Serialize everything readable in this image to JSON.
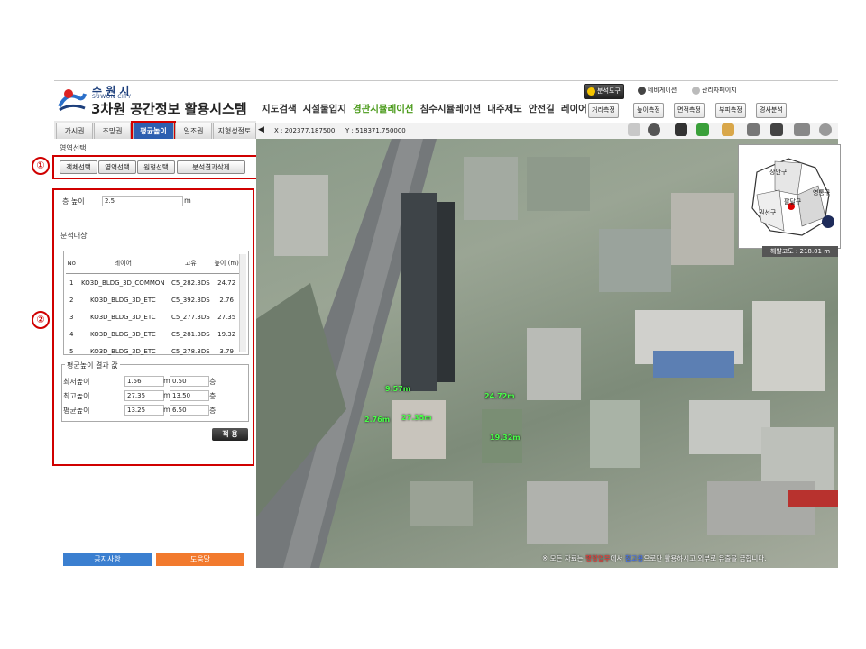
{
  "header": {
    "logo_city": "수 원 시",
    "logo_city_en": "SUWON CITY",
    "title": "3차원 공간정보 활용시스템",
    "nav": [
      "지도검색",
      "시설물입지",
      "경관시뮬레이션",
      "침수시뮬레이션",
      "내주제도",
      "안전길",
      "레이어"
    ],
    "nav_active_index": 2,
    "tools_row1": [
      "분석도구",
      "네비게이션",
      "관리자페이지"
    ],
    "tools_row2": [
      "거리측정",
      "높이측정",
      "면적측정",
      "부피측정",
      "경사분석"
    ]
  },
  "tabs": [
    "가시권",
    "조망권",
    "평균높이",
    "일조권",
    "지형성절토"
  ],
  "active_tab_index": 2,
  "coords": {
    "x": "X : 202377.187500",
    "y": "Y : 518371.750000"
  },
  "panel": {
    "area_select_label": "영역선택",
    "area_buttons": [
      "객체선택",
      "영역선택",
      "원형선택",
      "분석결과삭제"
    ],
    "marker1": "①",
    "marker2": "②",
    "height_label": "층 높이",
    "height_value": "2.5",
    "height_unit": "m",
    "target_label": "분석대상",
    "table": {
      "headers": [
        "No",
        "레이어",
        "고유",
        "높이 (m)"
      ],
      "rows": [
        [
          "1",
          "KO3D_BLDG_3D_COMMON",
          "C5_282.3DS",
          "24.72"
        ],
        [
          "2",
          "KO3D_BLDG_3D_ETC",
          "C5_392.3DS",
          "2.76"
        ],
        [
          "3",
          "KO3D_BLDG_3D_ETC",
          "C5_277.3DS",
          "27.35"
        ],
        [
          "4",
          "KO3D_BLDG_3D_ETC",
          "C5_281.3DS",
          "19.32"
        ],
        [
          "5",
          "KO3D_BLDG_3D_ETC",
          "C5_278.3DS",
          "3.79"
        ]
      ]
    },
    "result_title": "평균높이 결과 값",
    "results": [
      {
        "label": "최저높이",
        "m": "1.56",
        "floors": "0.50",
        "munit": "m",
        "funit": "층"
      },
      {
        "label": "최고높이",
        "m": "27.35",
        "floors": "13.50",
        "munit": "m",
        "funit": "층"
      },
      {
        "label": "평균높이",
        "m": "13.25",
        "floors": "6.50",
        "munit": "m",
        "funit": "층"
      }
    ],
    "apply_label": "적 용"
  },
  "bottom": {
    "notice_btn": "공지사항",
    "help_btn": "도움말"
  },
  "map": {
    "labels": [
      "9.57m",
      "24.72m",
      "2.76m",
      "27.35m",
      "19.32m"
    ],
    "altitude": "해발고도 : 218.01 m",
    "minimap_districts": [
      "장안구",
      "팔달구",
      "영통구",
      "권선구"
    ],
    "notice_prefix": "※ 모든 자료는 ",
    "notice_red": "행정업무",
    "notice_mid": "에서 ",
    "notice_blue": "참고용",
    "notice_suffix": "으로만 활용하시고 외부로 유출을 금합니다."
  },
  "colors": {
    "accent_blue": "#2d5fb0",
    "annotation_red": "#d00000",
    "label_green": "#48ff48"
  }
}
